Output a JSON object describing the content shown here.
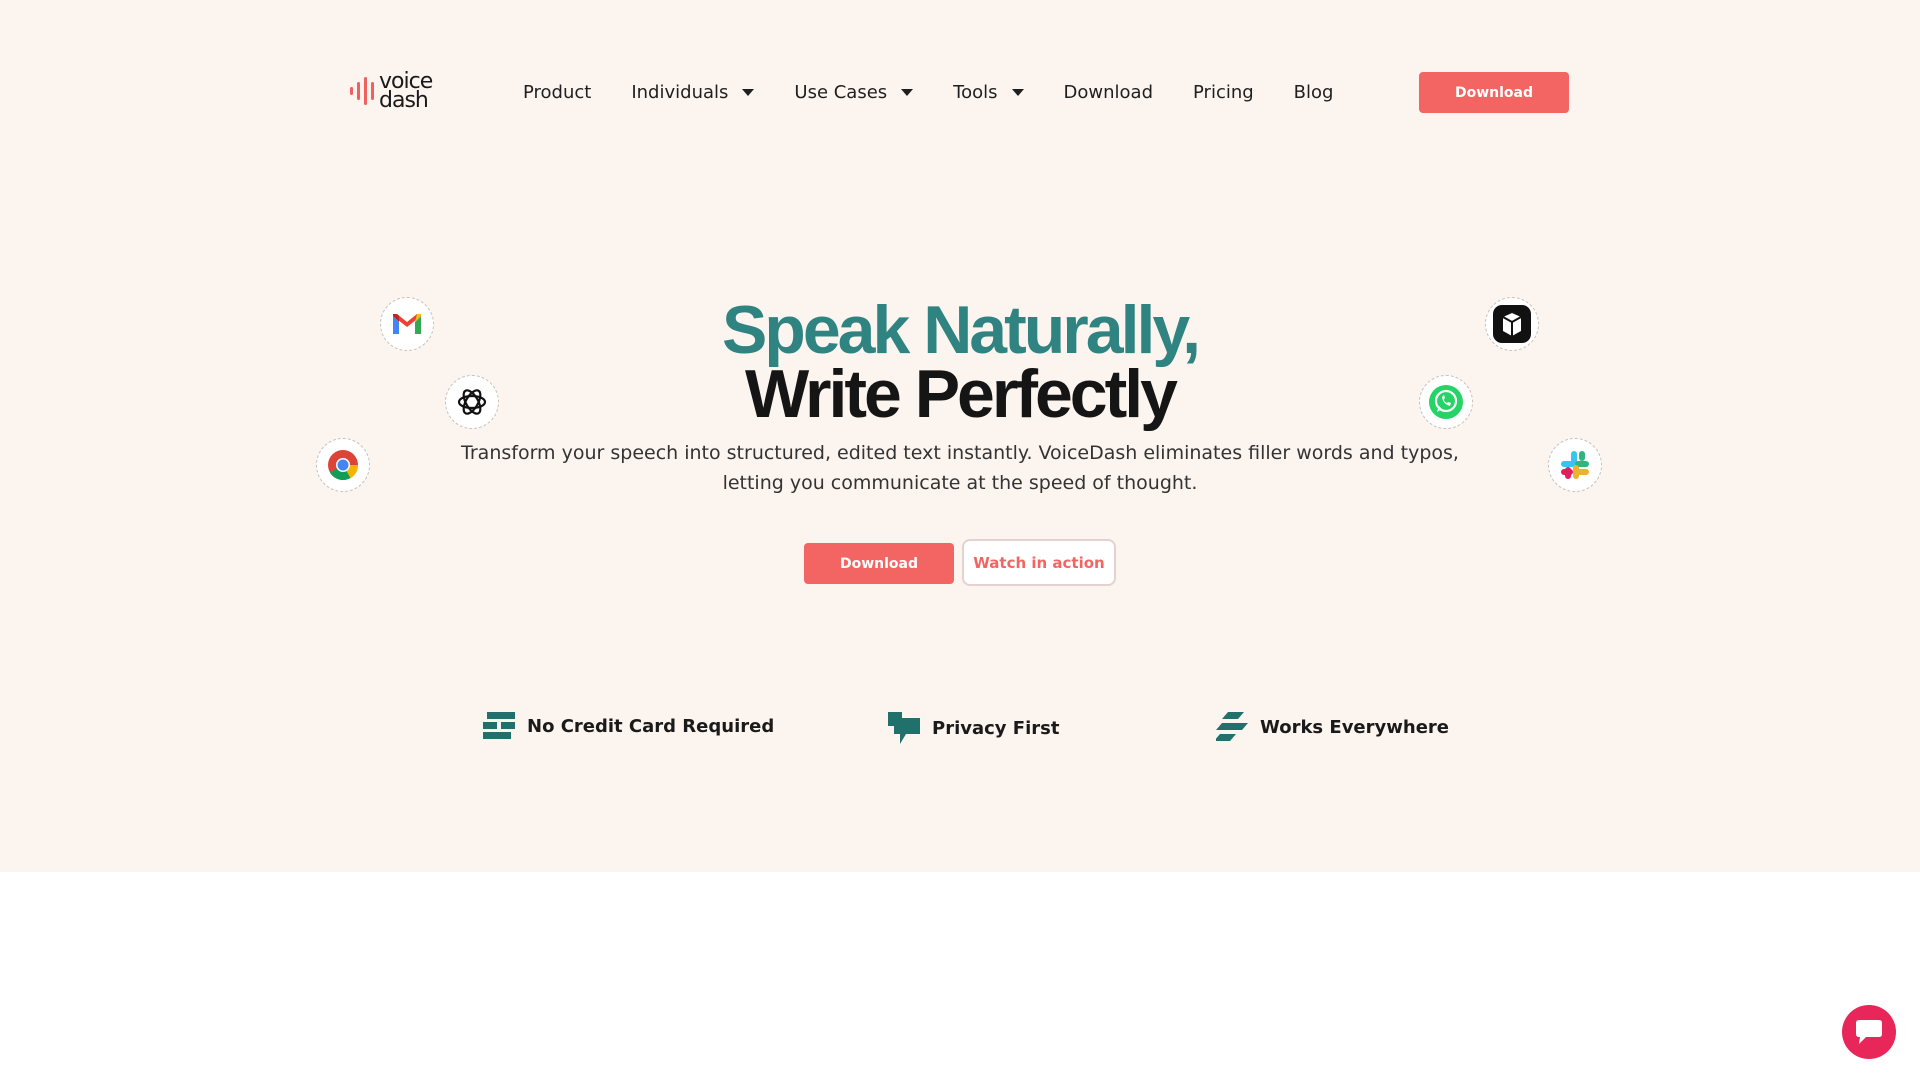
{
  "brand": {
    "logo_line1": "voice",
    "logo_line2": "dash",
    "accent": "#f26563",
    "teal": "#2f8380"
  },
  "nav": {
    "items": [
      {
        "label": "Product",
        "has_caret": false
      },
      {
        "label": "Individuals",
        "has_caret": true
      },
      {
        "label": "Use Cases",
        "has_caret": true
      },
      {
        "label": "Tools",
        "has_caret": true
      },
      {
        "label": "Download",
        "has_caret": false
      },
      {
        "label": "Pricing",
        "has_caret": false
      },
      {
        "label": "Blog",
        "has_caret": false
      }
    ],
    "cta_label": "Download"
  },
  "hero": {
    "title_line1": "Speak Naturally,",
    "title_line2": "Write Perfectly",
    "subtitle": "Transform your speech into structured, edited text instantly. VoiceDash eliminates filler words and typos, letting you communicate at the speed of thought.",
    "primary_cta": "Download",
    "secondary_cta": "Watch in action"
  },
  "app_icons": [
    "gmail-icon",
    "chatgpt-icon",
    "chrome-icon",
    "perplexity-icon",
    "whatsapp-icon",
    "slack-icon"
  ],
  "features": [
    {
      "label": "No Credit Card Required",
      "icon": "stacked-bars-icon"
    },
    {
      "label": "Privacy First",
      "icon": "flag-icon"
    },
    {
      "label": "Works Everywhere",
      "icon": "stripes-icon"
    }
  ]
}
